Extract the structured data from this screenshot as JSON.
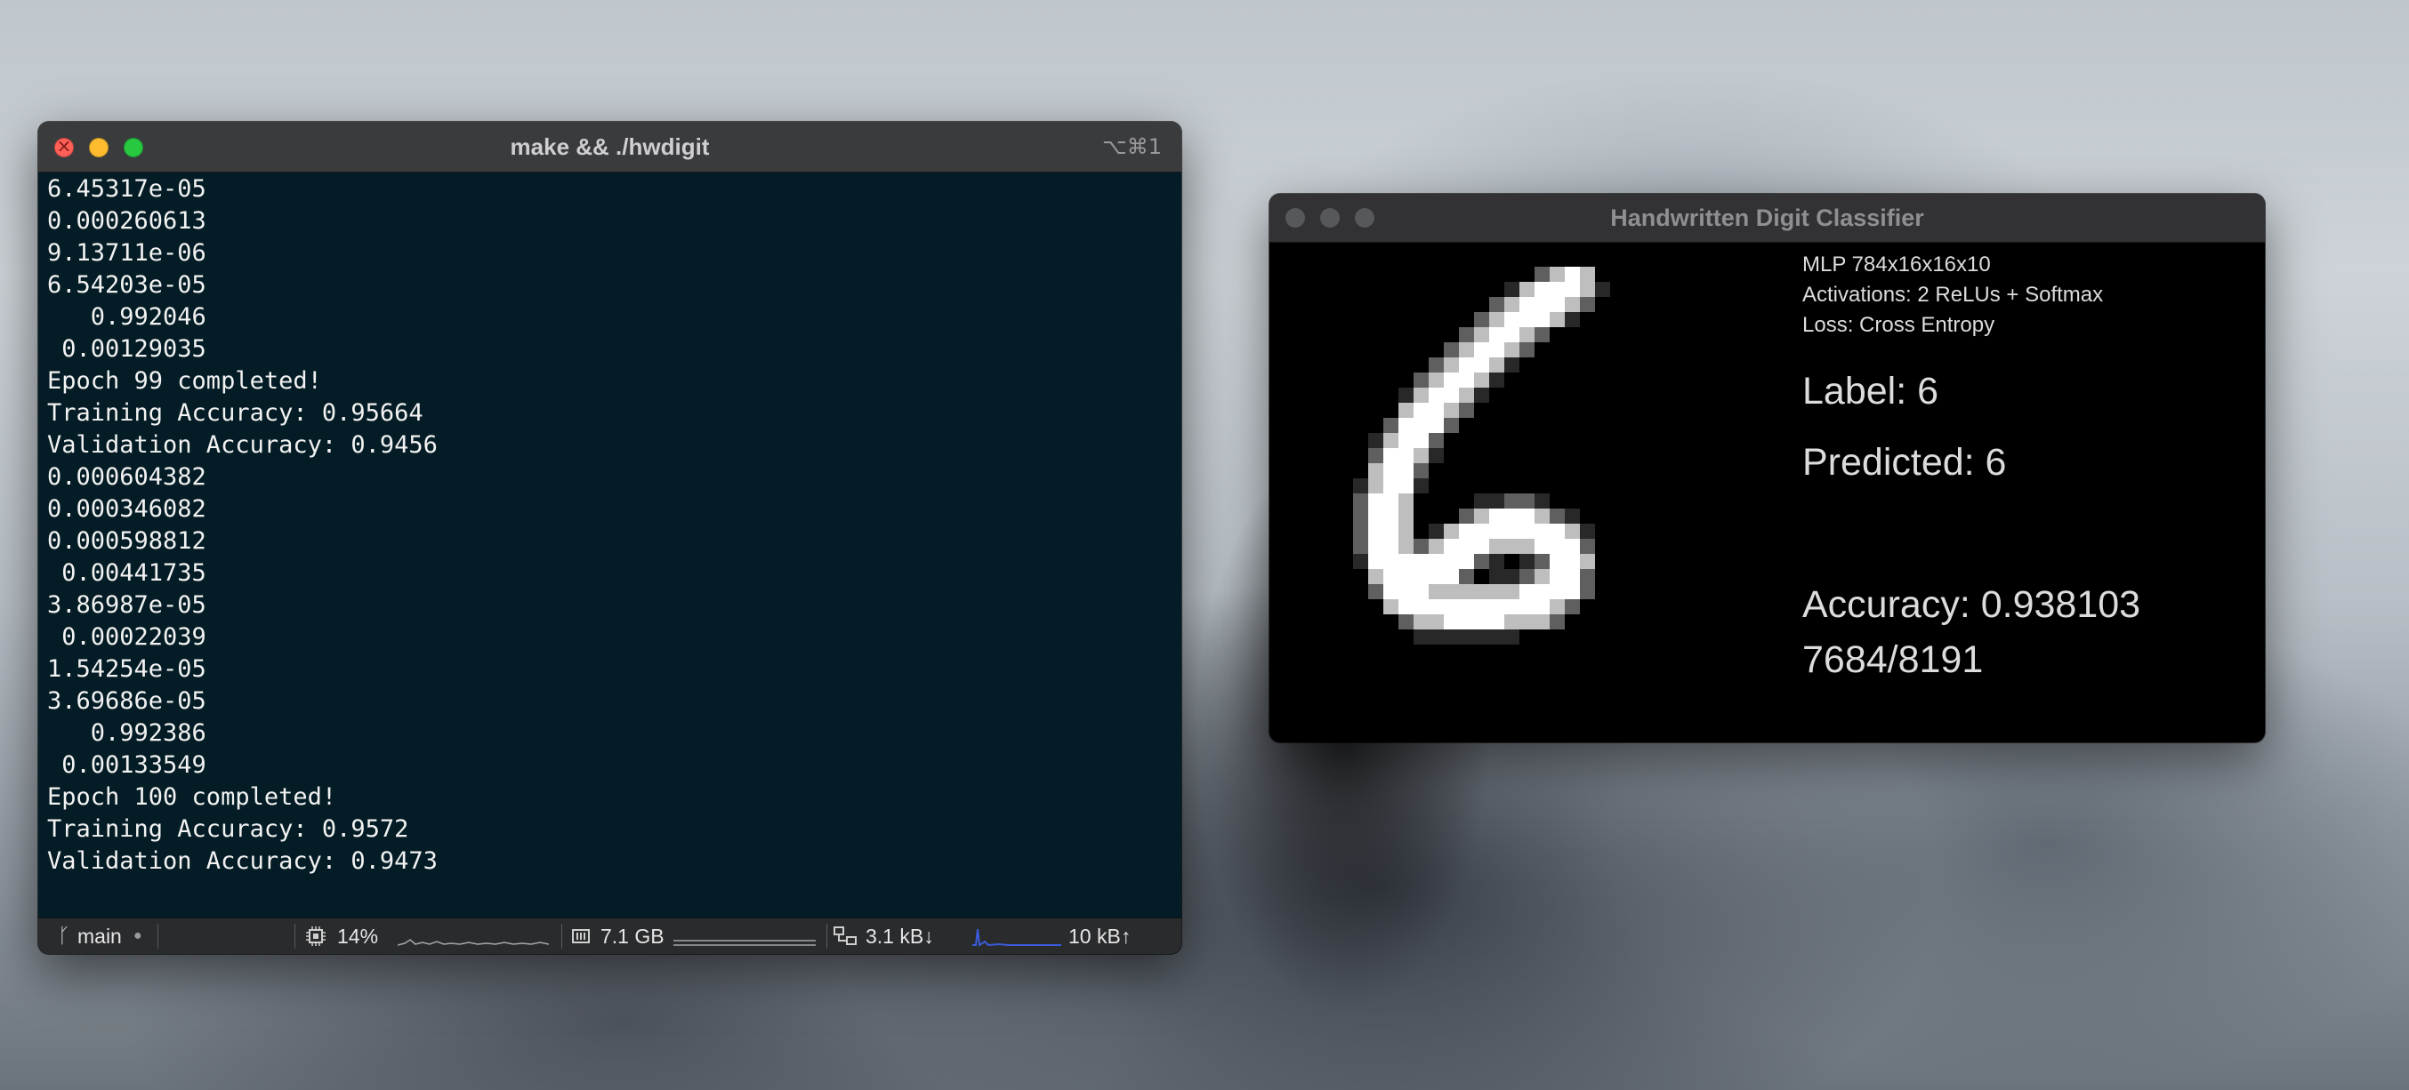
{
  "terminal": {
    "title": "make && ./hwdigit",
    "shortcut": "⌥⌘1",
    "output_lines": [
      "6.45317e-05",
      "0.000260613",
      "9.13711e-06",
      "6.54203e-05",
      "   0.992046",
      " 0.00129035",
      "Epoch 99 completed!",
      "Training Accuracy: 0.95664",
      "Validation Accuracy: 0.9456",
      "0.000604382",
      "0.000346082",
      "0.000598812",
      " 0.00441735",
      "3.86987e-05",
      " 0.00022039",
      "1.54254e-05",
      "3.69686e-05",
      "   0.992386",
      " 0.00133549",
      "Epoch 100 completed!",
      "Training Accuracy: 0.9572",
      "Validation Accuracy: 0.9473"
    ],
    "status_bar": {
      "branch": "main",
      "cpu": "14%",
      "memory": "7.1 GB",
      "net_down": "3.1 kB↓",
      "net_up": "10 kB↑",
      "branch_icon": "git-branch-icon",
      "cpu_icon": "cpu-icon",
      "memory_icon": "memory-icon",
      "network_icon": "network-icon"
    }
  },
  "classifier": {
    "title": "Handwritten Digit Classifier",
    "model": "MLP 784x16x16x10",
    "activations": "Activations: 2 ReLUs + Softmax",
    "loss": "Loss: Cross Entropy",
    "label": "Label: 6",
    "predicted": "Predicted: 6",
    "accuracy": "Accuracy: 0.938103",
    "count": "7684/8191",
    "predicted_color": "#59d24c"
  }
}
